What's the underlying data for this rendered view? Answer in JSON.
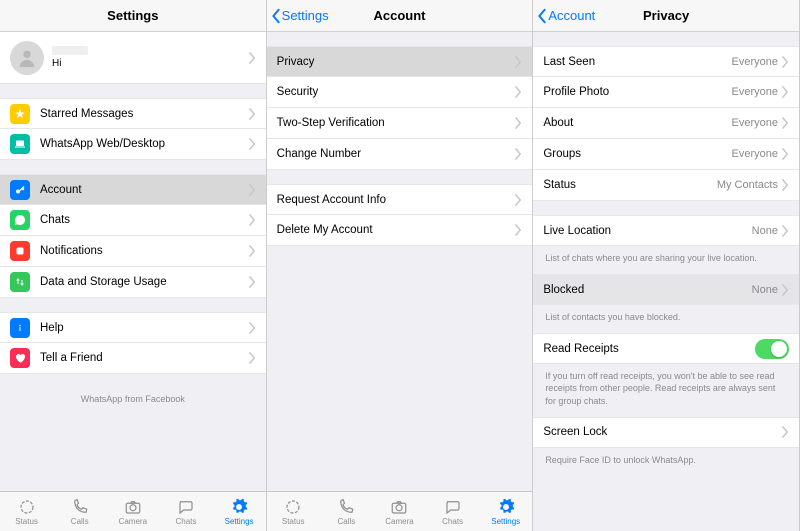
{
  "colors": {
    "star": "#ffcc00",
    "web": "#00c853",
    "account": "#007aff",
    "chats": "#25d366",
    "notif": "#ff3b30",
    "data": "#34c759",
    "help": "#007aff",
    "tell": "#ff2d55"
  },
  "panel1": {
    "title": "Settings",
    "profile_status": "Hi",
    "rows": {
      "starred": "Starred Messages",
      "web": "WhatsApp Web/Desktop",
      "account": "Account",
      "chats": "Chats",
      "notif": "Notifications",
      "data": "Data and Storage Usage",
      "help": "Help",
      "tell": "Tell a Friend"
    },
    "attribution": "WhatsApp from Facebook"
  },
  "panel2": {
    "back": "Settings",
    "title": "Account",
    "rows": {
      "privacy": "Privacy",
      "security": "Security",
      "twostep": "Two-Step Verification",
      "change": "Change Number",
      "request": "Request Account Info",
      "delete": "Delete My Account"
    }
  },
  "panel3": {
    "back": "Account",
    "title": "Privacy",
    "rows": {
      "last_seen": {
        "label": "Last Seen",
        "value": "Everyone"
      },
      "photo": {
        "label": "Profile Photo",
        "value": "Everyone"
      },
      "about": {
        "label": "About",
        "value": "Everyone"
      },
      "groups": {
        "label": "Groups",
        "value": "Everyone"
      },
      "status": {
        "label": "Status",
        "value": "My Contacts"
      },
      "live": {
        "label": "Live Location",
        "value": "None"
      },
      "blocked": {
        "label": "Blocked",
        "value": "None"
      },
      "receipts": {
        "label": "Read Receipts"
      },
      "screenlock": {
        "label": "Screen Lock"
      }
    },
    "footers": {
      "live": "List of chats where you are sharing your live location.",
      "blocked": "List of contacts you have blocked.",
      "receipts": "If you turn off read receipts, you won't be able to see read receipts from other people. Read receipts are always sent for group chats.",
      "screenlock": "Require Face ID to unlock WhatsApp."
    }
  },
  "tabs": {
    "status": "Status",
    "calls": "Calls",
    "camera": "Camera",
    "chats": "Chats",
    "settings": "Settings"
  }
}
